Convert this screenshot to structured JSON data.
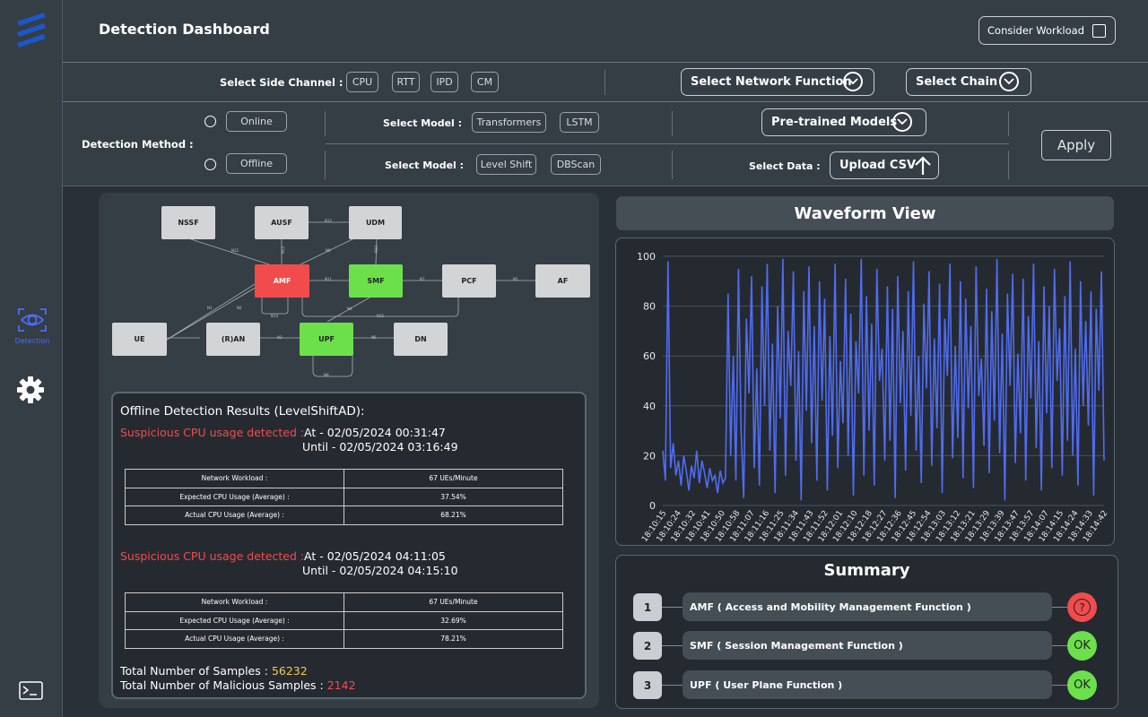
{
  "sidebar": {
    "detection_label": "Detection"
  },
  "header": {
    "title": "Detection Dashboard",
    "consider_workload_label": "Consider Workload"
  },
  "side_channel": {
    "label": "Select Side Channel :",
    "options": [
      "CPU",
      "RTT",
      "IPD",
      "CM"
    ],
    "network_function_label": "Select Network Function",
    "chain_label": "Select Chain"
  },
  "detection": {
    "method_label": "Detection Method :",
    "online_label": "Online",
    "offline_label": "Offline",
    "select_model_label": "Select Model :",
    "online_models": [
      "Transformers",
      "LSTM"
    ],
    "offline_models": [
      "Level Shift",
      "DBScan"
    ],
    "pretrained_label": "Pre-trained Models",
    "select_data_label": "Select Data :",
    "upload_label": "Upload CSV",
    "apply_label": "Apply"
  },
  "topology": {
    "nodes": [
      "NSSF",
      "AUSF",
      "UDM",
      "AMF",
      "SMF",
      "PCF",
      "AF",
      "UE",
      "(R)AN",
      "UPF",
      "DN"
    ],
    "edge_labels": [
      "N22",
      "N12",
      "N8",
      "N13",
      "N10",
      "N11",
      "N7",
      "N5",
      "N14",
      "N1",
      "N2",
      "N4",
      "N15",
      "N3",
      "N6",
      "N9"
    ],
    "status_colors": {
      "alert": "#f24b4b",
      "ok": "#6be04b"
    }
  },
  "results": {
    "title": "Offline Detection Results (LevelShiftAD):",
    "events": [
      {
        "alert": "Suspicious CPU usage detected :",
        "at": "At  - 02/05/2024 00:31:47",
        "until": "Until  - 02/05/2024 03:16:49",
        "rows": [
          {
            "label": "Network Workload :",
            "value": "67 UEs/Minute"
          },
          {
            "label": "Expected CPU Usage (Average) :",
            "value": "37.54%"
          },
          {
            "label": "Actual CPU Usage (Average) :",
            "value": "68.21%"
          }
        ]
      },
      {
        "alert": "Suspicious CPU usage detected :",
        "at": "At  - 02/05/2024 04:11:05",
        "until": "Until  - 02/05/2024 04:15:10",
        "rows": [
          {
            "label": "Network Workload :",
            "value": "67 UEs/Minute"
          },
          {
            "label": "Expected CPU Usage (Average) :",
            "value": "32.69%"
          },
          {
            "label": "Actual CPU Usage (Average) :",
            "value": "78.21%"
          }
        ]
      }
    ],
    "total_samples_label": "Total Number of Samples :",
    "total_samples": "56232",
    "total_malicious_label": "Total Number of Malicious Samples :",
    "total_malicious": "2142"
  },
  "waveform": {
    "title": "Waveform View"
  },
  "chart_data": {
    "type": "line",
    "title": "",
    "xlabel": "",
    "ylabel": "",
    "ylim": [
      0,
      100
    ],
    "yticks": [
      0,
      20,
      40,
      60,
      80,
      100
    ],
    "grid": true,
    "color": "#4f6cf0",
    "x_tick_labels": [
      "18:10:15",
      "18:10:24",
      "18:10:32",
      "18:10:41",
      "18:10:50",
      "18:10:58",
      "18:11:07",
      "18:11:16",
      "18:11:25",
      "18:11:34",
      "18:11:43",
      "18:11:52",
      "18:12:01",
      "18:12:10",
      "18:12:18",
      "18:12:27",
      "18:12:36",
      "18:12:45",
      "18:12:54",
      "18:13:03",
      "18:13:12",
      "18:13:21",
      "18:13:29",
      "18:13:39",
      "18:13:47",
      "18:13:57",
      "18:14:07",
      "18:14:15",
      "18:14:24",
      "18:14:33",
      "18:14:42"
    ],
    "series": [
      {
        "values": [
          22,
          10,
          98,
          15,
          25,
          12,
          18,
          8,
          20,
          14,
          6,
          16,
          11,
          22,
          9,
          18,
          13,
          7,
          15,
          10,
          12,
          5,
          14,
          9,
          11,
          85,
          20,
          60,
          10,
          95,
          30,
          3,
          75,
          45,
          92,
          15,
          55,
          8,
          88,
          40,
          97,
          22,
          65,
          5,
          80,
          35,
          99,
          12,
          70,
          48,
          94,
          18,
          62,
          2,
          86,
          38,
          96,
          25,
          72,
          10,
          90,
          42,
          83,
          6,
          68,
          28,
          97,
          15,
          58,
          33,
          91,
          20,
          77,
          4,
          66,
          45,
          99,
          12,
          84,
          30,
          73,
          8,
          95,
          50,
          63,
          18,
          88,
          26,
          79,
          3,
          92,
          41,
          70,
          14,
          86,
          36,
          98,
          22,
          60,
          9,
          81,
          47,
          94,
          16,
          67,
          31,
          89,
          5,
          75,
          52,
          97,
          19,
          64,
          27,
          90,
          11,
          83,
          39,
          72,
          7,
          96,
          44,
          59,
          24,
          87,
          13,
          78,
          34,
          99,
          21,
          69,
          2,
          85,
          48,
          93,
          17,
          61,
          29,
          91,
          10,
          76,
          43,
          97,
          23,
          66,
          6,
          88,
          37,
          80,
          15,
          95,
          50,
          71,
          12,
          84,
          26,
          98,
          20,
          63,
          8,
          90,
          40,
          74,
          32,
          86,
          4,
          79,
          46,
          94,
          18
        ]
      }
    ]
  },
  "summary": {
    "title": "Summary",
    "items": [
      {
        "num": "1",
        "label": "AMF ( Access and Mobility Management Function )",
        "status": "?"
      },
      {
        "num": "2",
        "label": "SMF ( Session Management Function )",
        "status": "OK"
      },
      {
        "num": "3",
        "label": "UPF ( User Plane Function )",
        "status": "OK"
      }
    ],
    "colors": {
      "alert": "#f24b4b",
      "ok": "#6be04b"
    }
  }
}
